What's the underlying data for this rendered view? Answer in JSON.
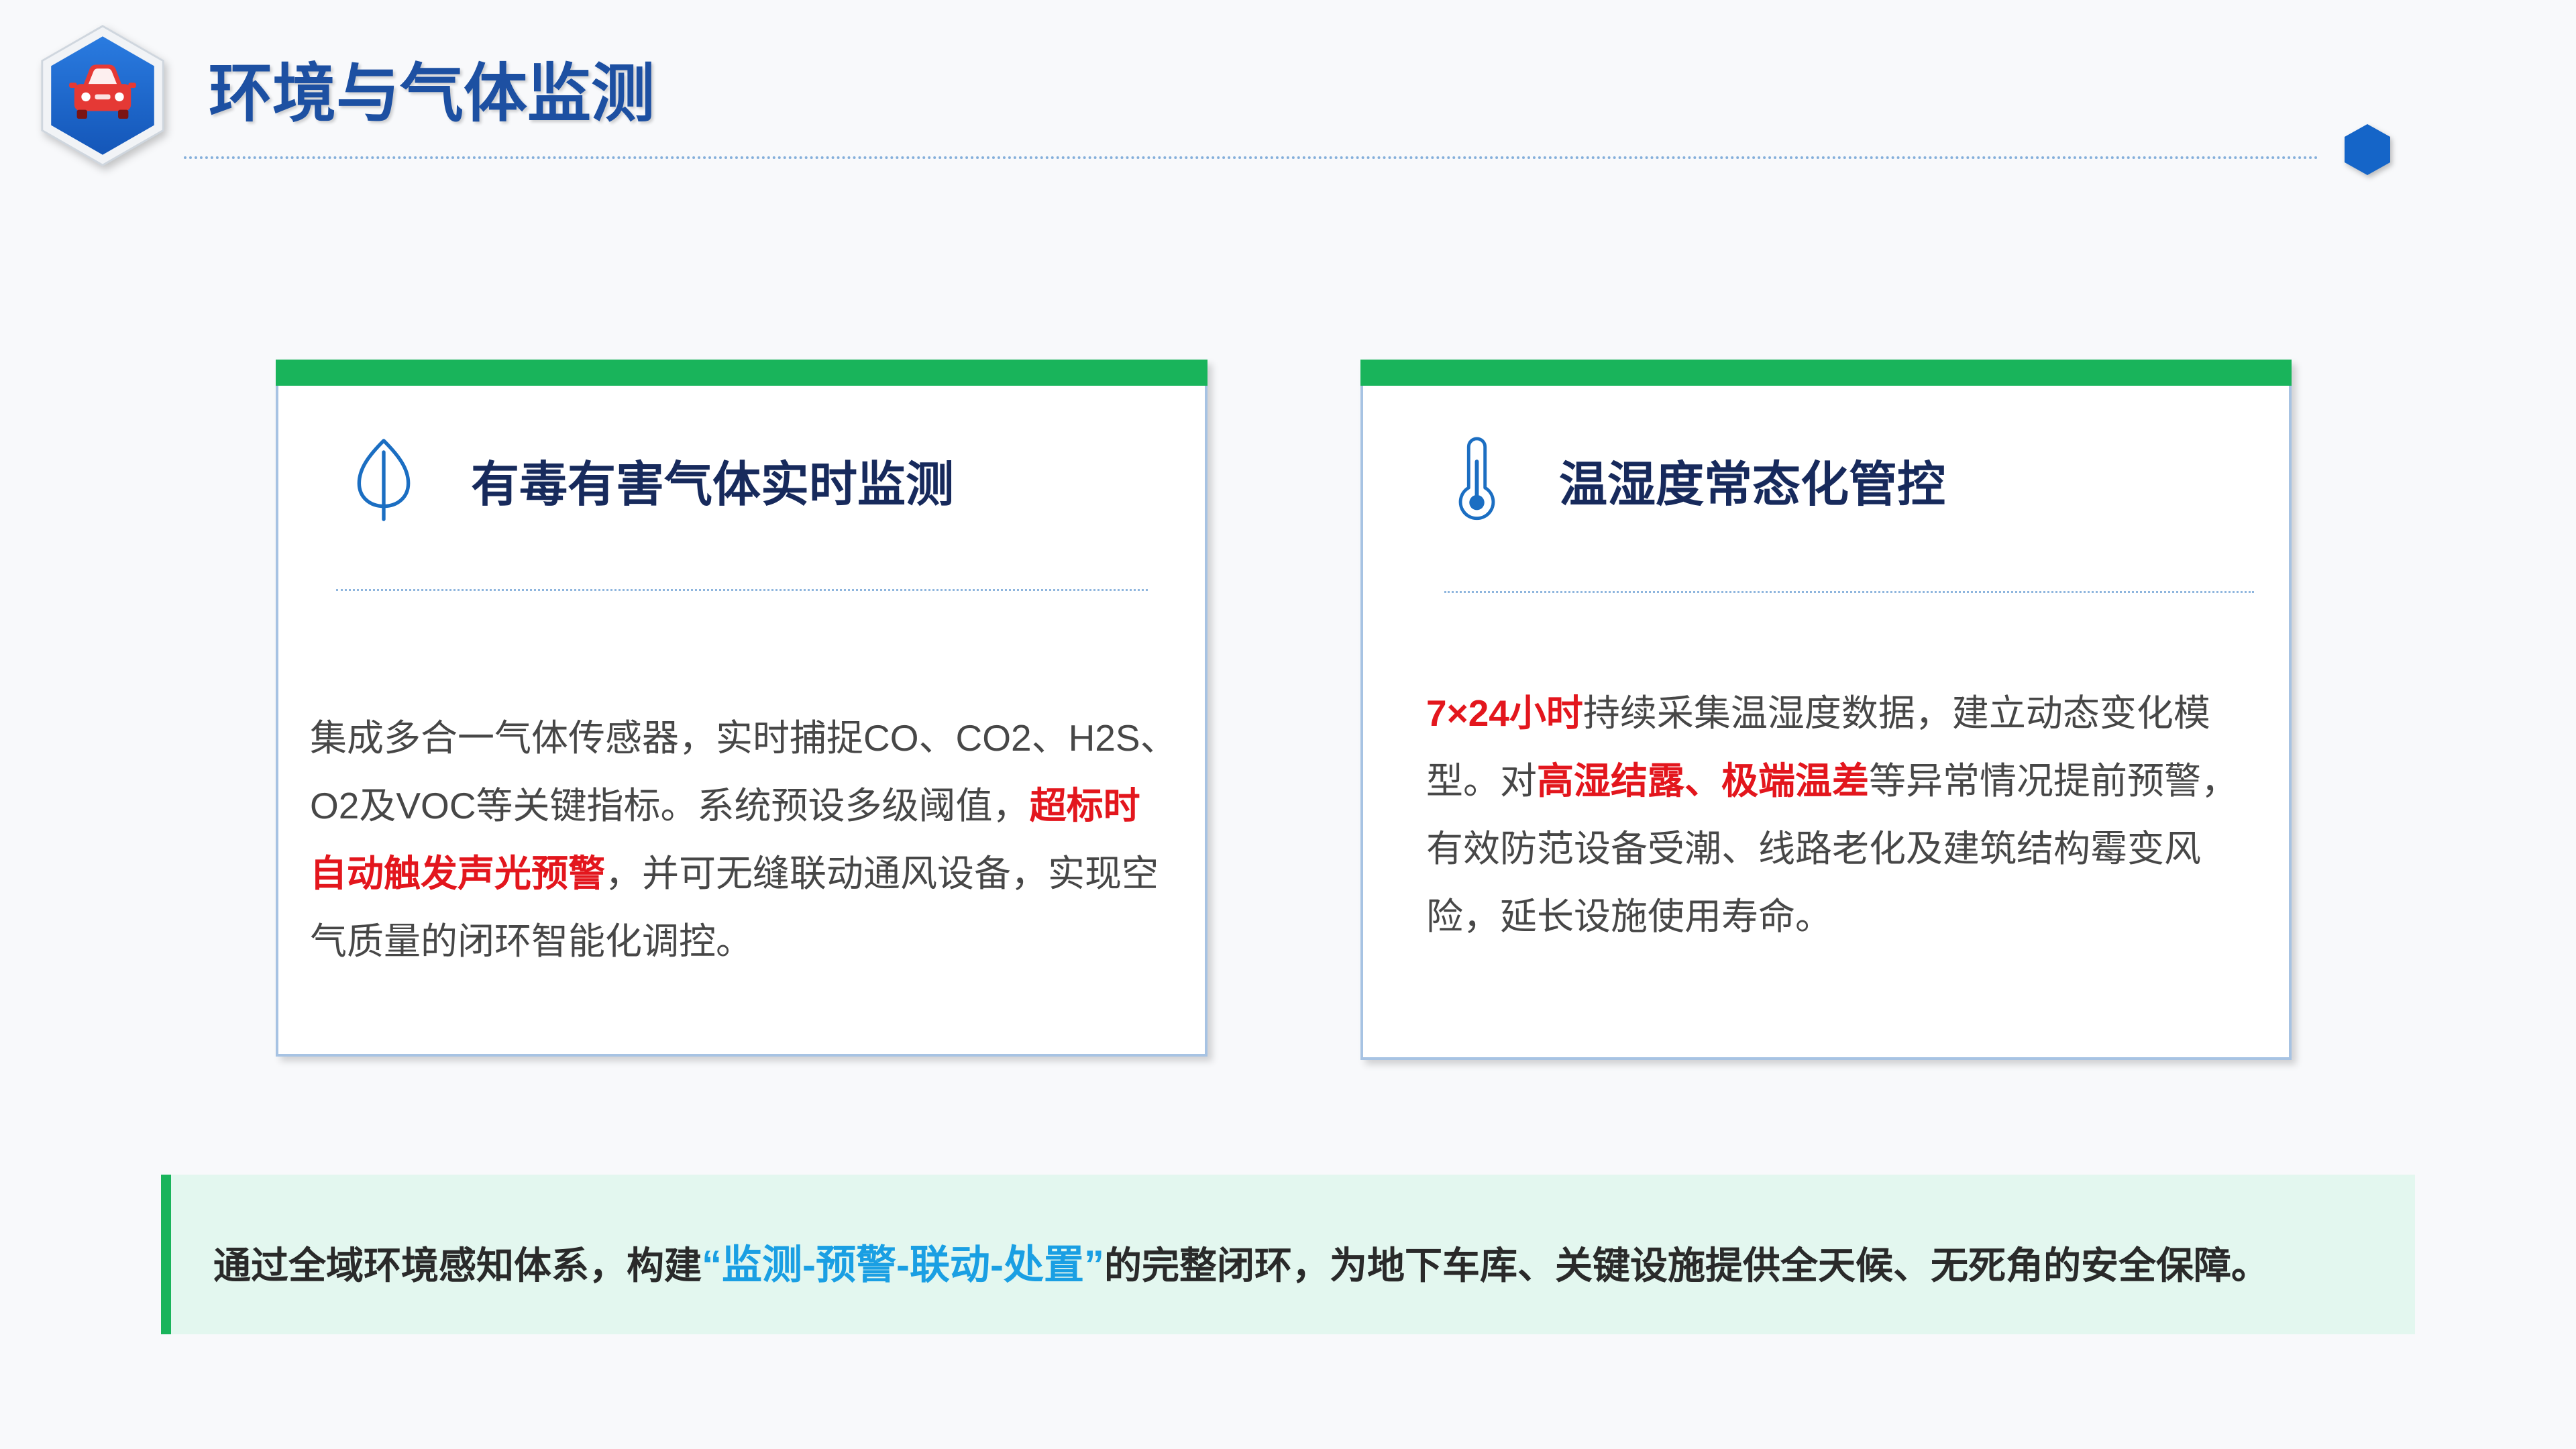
{
  "header": {
    "title": "环境与气体监测",
    "logo_icon": "car-icon",
    "accent_icon": "hexagon-icon"
  },
  "left_card": {
    "icon": "leaf-icon",
    "title": "有毒有害气体实时监测",
    "body": [
      [
        {
          "text": "集成多合一气体传感器，实时捕捉CO、CO2、H2S、"
        }
      ],
      [
        {
          "text": "O2及VOC等关键指标。系统预设多级阈值，"
        },
        {
          "text": "超标时",
          "highlight": true
        }
      ],
      [
        {
          "text": "自动触发声光预警",
          "highlight": true
        },
        {
          "text": "，并可无缝联动通风设备，实现空"
        }
      ],
      [
        {
          "text": "气质量的闭环智能化调控。"
        }
      ]
    ]
  },
  "right_card": {
    "icon": "thermometer-icon",
    "title": "温湿度常态化管控",
    "body": [
      [
        {
          "text": "7×24小时",
          "highlight": true
        },
        {
          "text": "持续采集温湿度数据，建立动态变化模"
        }
      ],
      [
        {
          "text": "型。对"
        },
        {
          "text": "高湿结露、极端温差",
          "highlight": true
        },
        {
          "text": "等异常情况提前预警，"
        }
      ],
      [
        {
          "text": "有效防范设备受潮、线路老化及建筑结构霉变风"
        }
      ],
      [
        {
          "text": "险，延长设施使用寿命。"
        }
      ]
    ]
  },
  "banner": {
    "segments": [
      {
        "text": "通过全域环境感知体系，构建"
      },
      {
        "text": "“监测-预警-联动-处置”",
        "highlight": true
      },
      {
        "text": "的完整闭环，为地下车库、关键设施提供全天候、无死角的安全保障。"
      }
    ]
  },
  "colors": {
    "background": "#f8f9fb",
    "title_blue": "#1d50a2",
    "card_title": "#172a5c",
    "body_text": "#474747",
    "highlight_red": "#e3161d",
    "accent_green": "#19b45b",
    "card_border": "#a7c3e3",
    "icon_blue": "#1b6ec2",
    "banner_bg": "#e3f7ef",
    "banner_highlight": "#1a9fe3",
    "banner_text": "#2a2a2a"
  }
}
